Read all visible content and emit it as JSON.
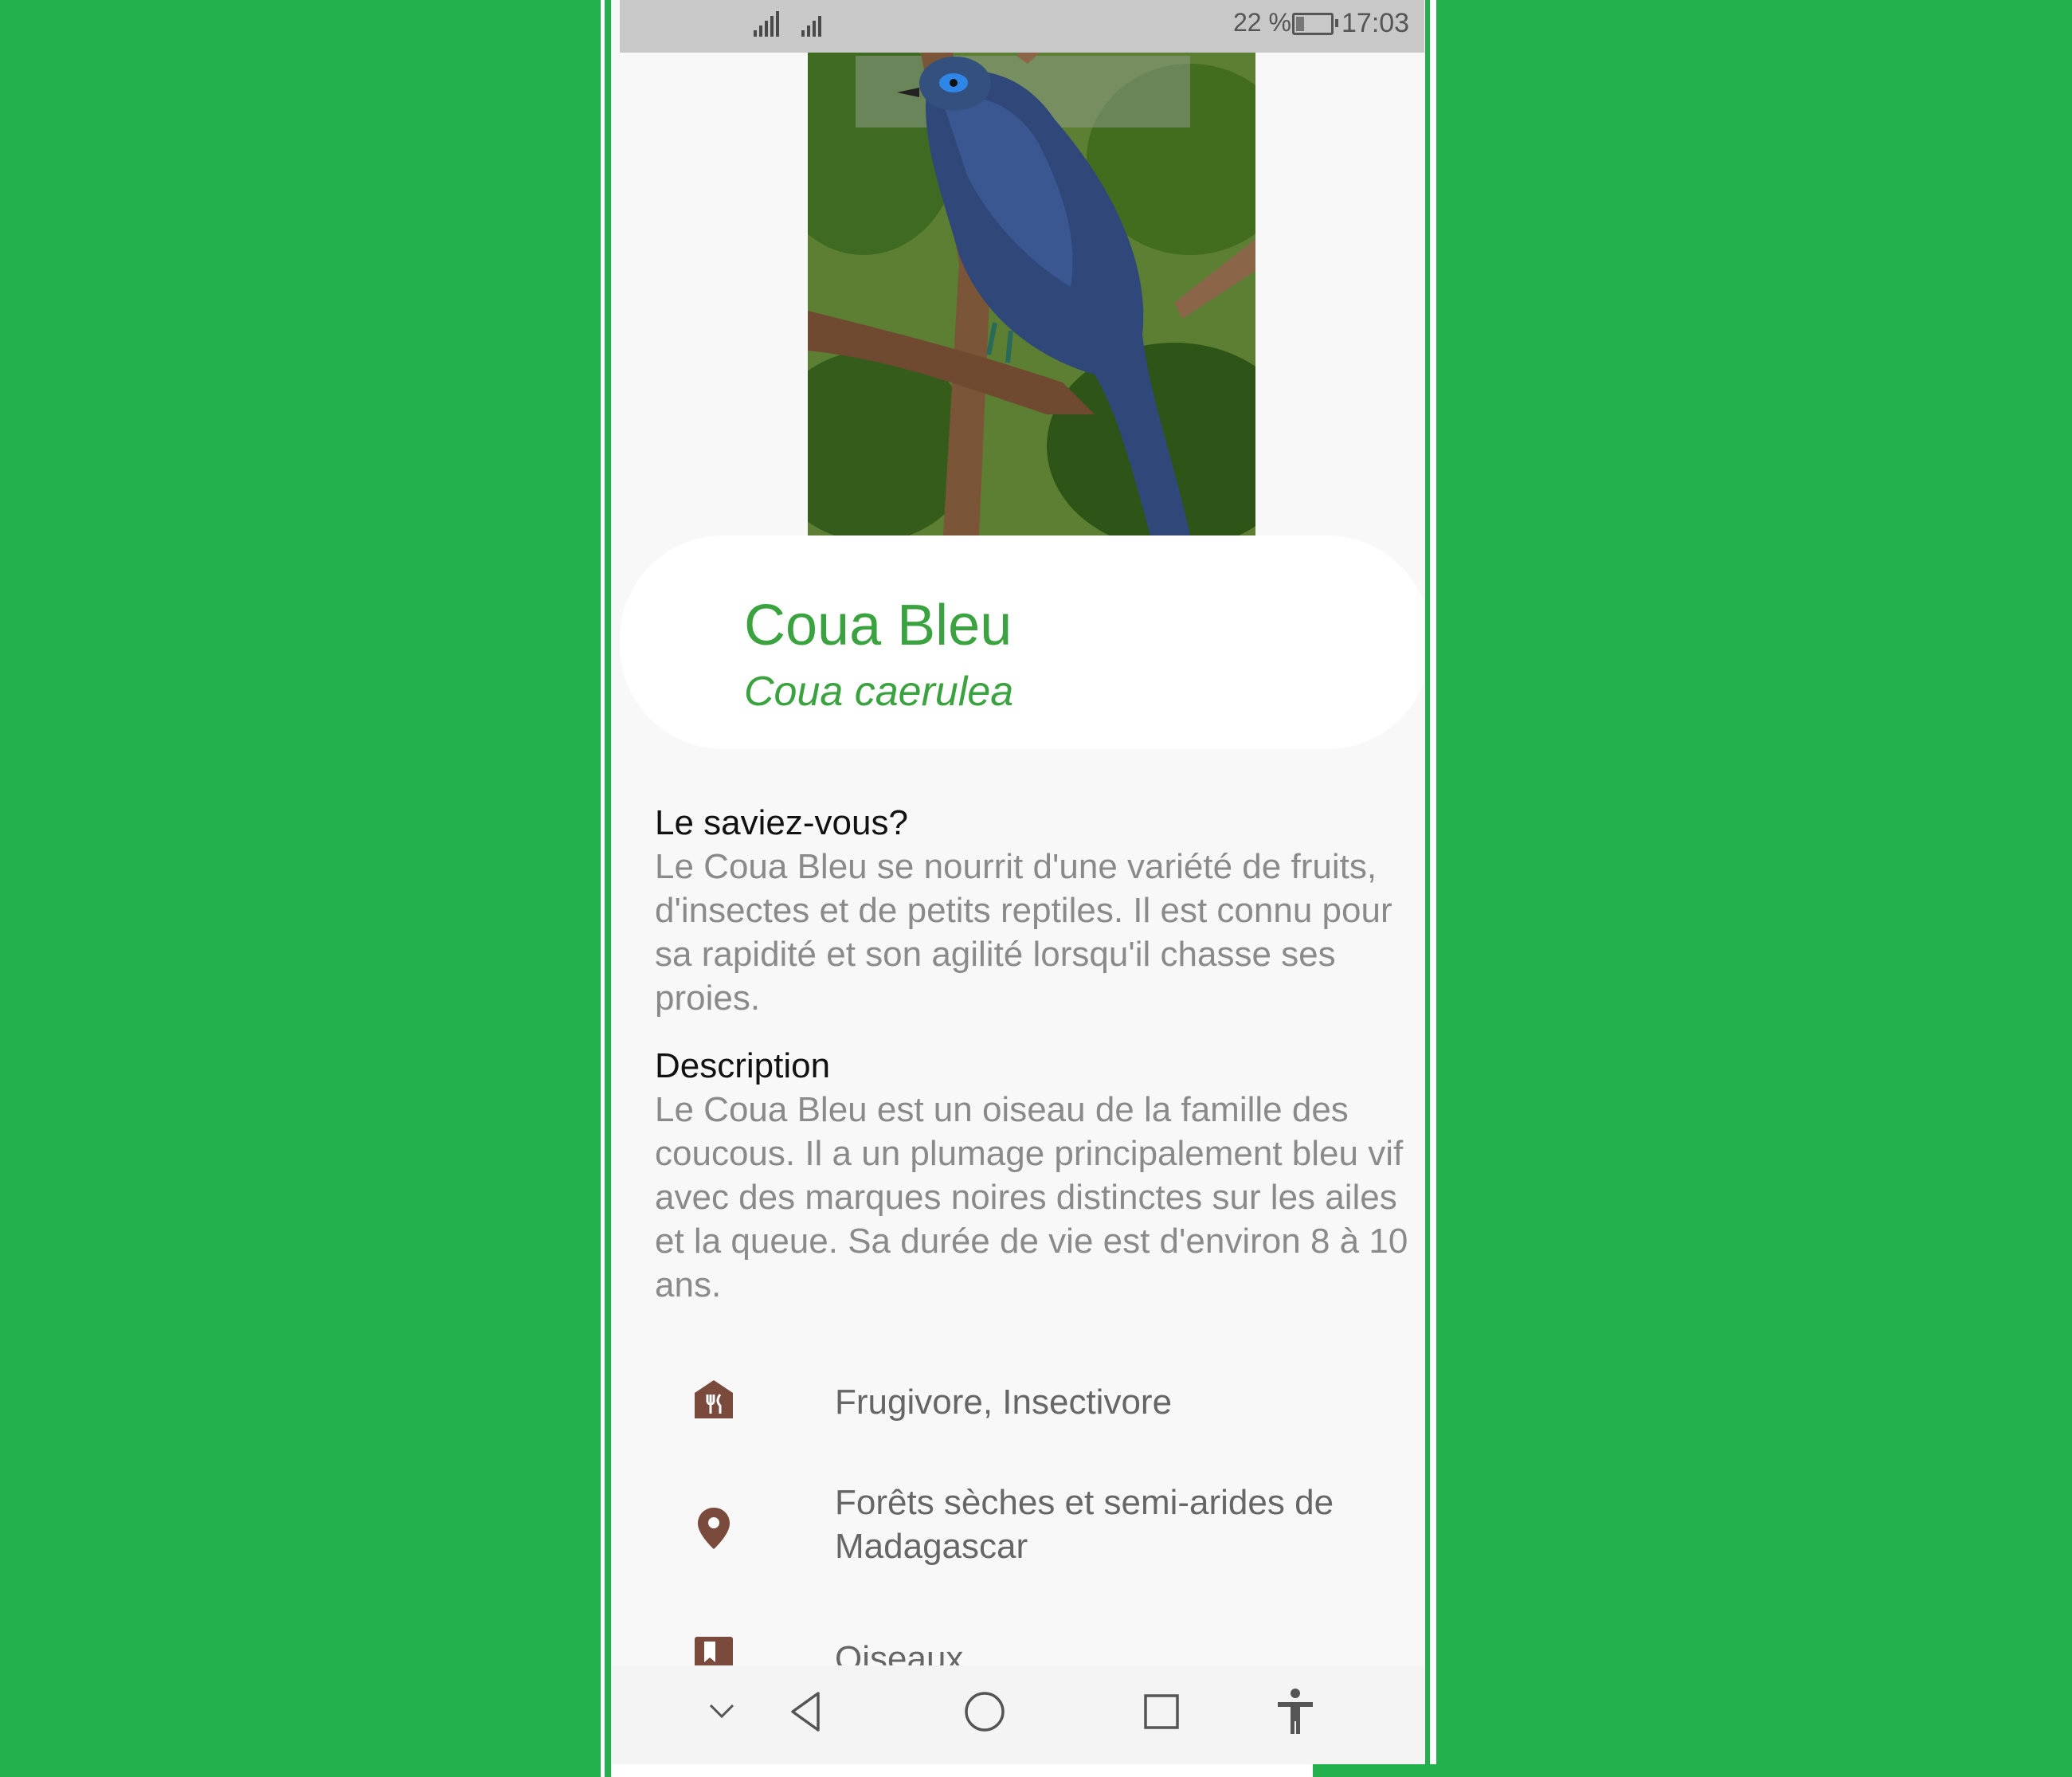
{
  "status_bar": {
    "battery": "22 %",
    "time": "17:03",
    "battery_level": 0.22
  },
  "hero_image": {
    "alt": "Coua Bleu photo"
  },
  "animal": {
    "common_name": "Coua Bleu",
    "scientific_name": "Coua caerulea"
  },
  "facts": {
    "title": "Le saviez-vous?",
    "text": "Le Coua Bleu se nourrit d'une variété de fruits, d'insectes et de petits reptiles. Il est connu pour sa rapidité et son agilité lorsqu'il chasse ses proies."
  },
  "description": {
    "title": "Description",
    "text": "Le Coua Bleu est un oiseau de la famille des coucous. Il a un plumage principalement bleu vif avec des marques noires distinctes sur les ailes et la queue. Sa durée de vie est d'environ 8 à 10 ans."
  },
  "info": [
    {
      "icon": "restaurant-icon",
      "text": "Frugivore, Insectivore"
    },
    {
      "icon": "location-pin-icon",
      "text": "Forêts sèches et semi-arides de Madagascar"
    },
    {
      "icon": "bookmark-icon",
      "text": "Oiseaux"
    }
  ],
  "nav": {
    "icons": [
      "chevron-down-icon",
      "back-icon",
      "home-icon",
      "recents-icon",
      "accessibility-icon"
    ]
  },
  "colors": {
    "accent": "#3aa340",
    "icon_brown": "#7a4a3c",
    "background_green": "#23b14d"
  }
}
